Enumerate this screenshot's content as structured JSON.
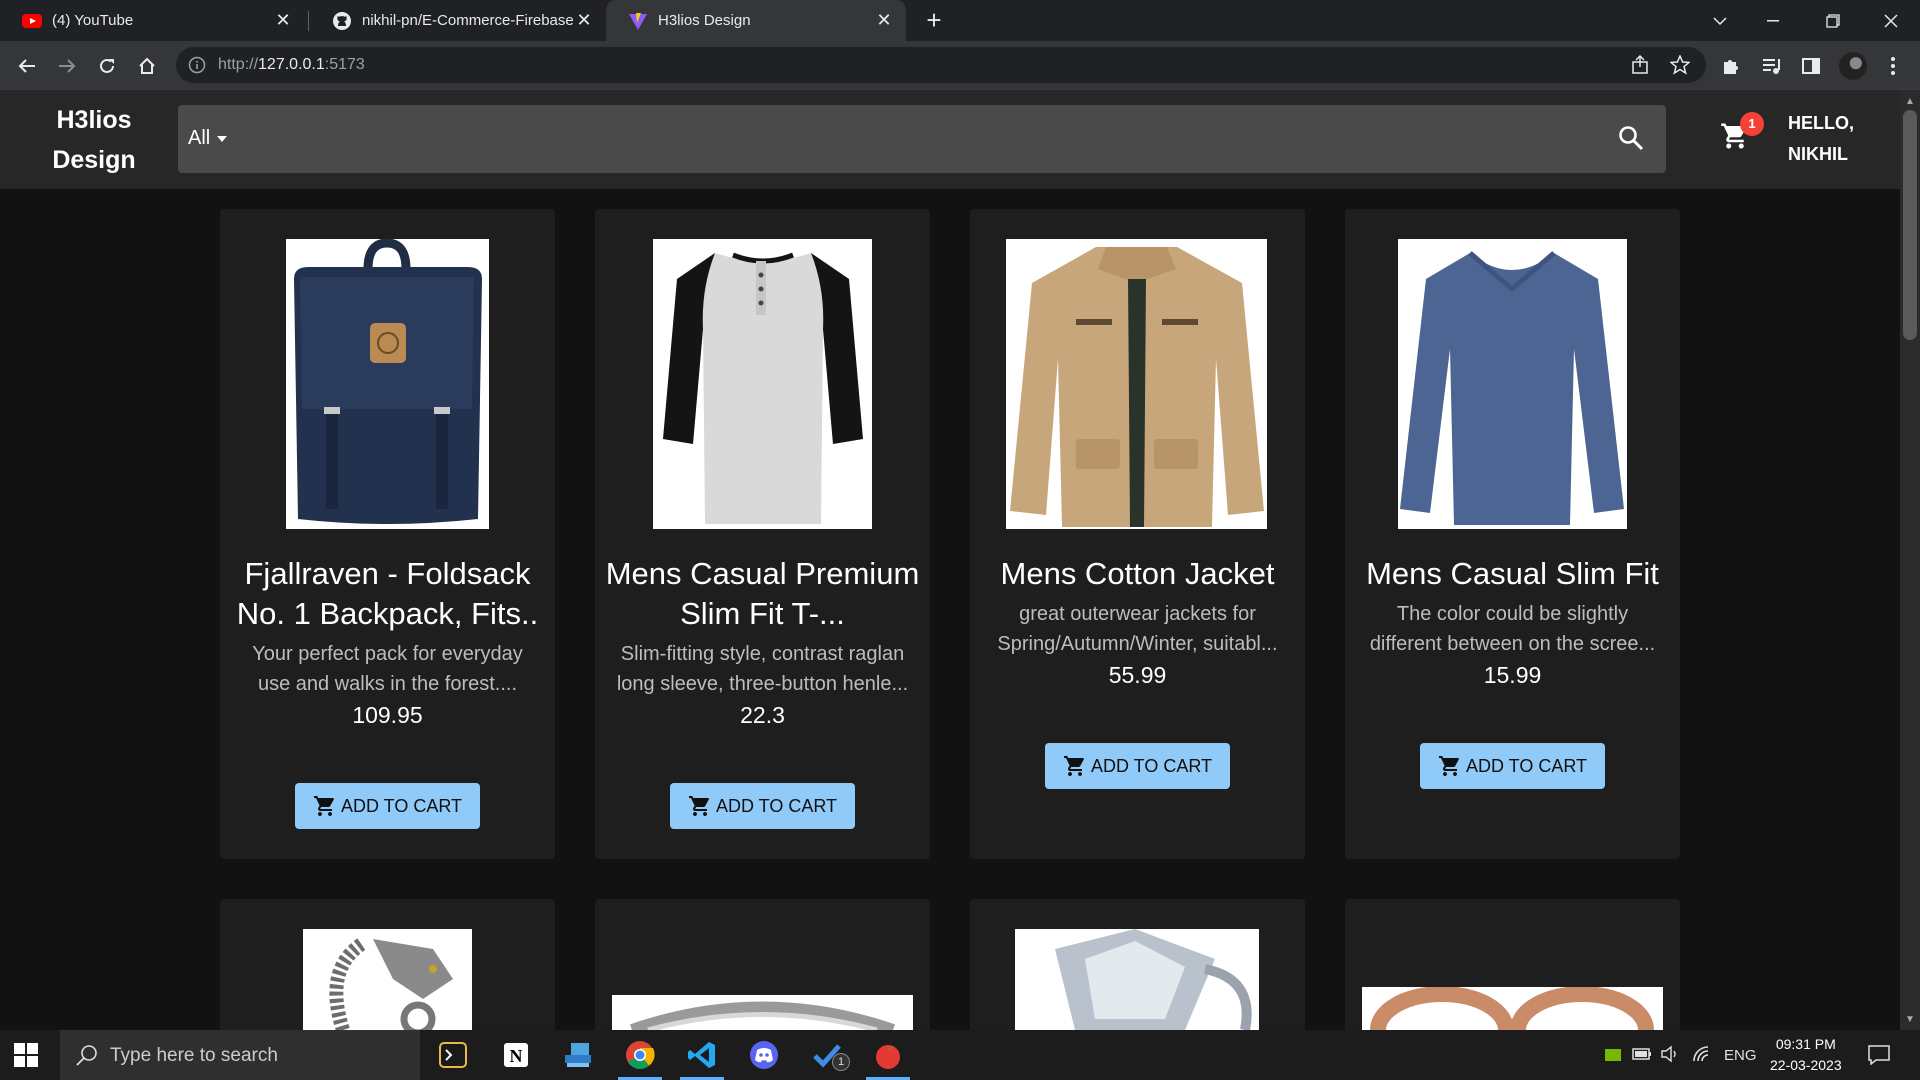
{
  "browser": {
    "tabs": [
      {
        "title": "(4) YouTube"
      },
      {
        "title": "nikhil-pn/E-Commerce-Firebase-"
      },
      {
        "title": "H3lios Design"
      }
    ],
    "url_prefix": "http://",
    "url_host": "127.0.0.1",
    "url_port": ":5173"
  },
  "app": {
    "brand": "H3lios\nDesign",
    "search_category": "All",
    "cart_count": "1",
    "greeting_line1": "HELLO,",
    "greeting_line2": "NIKHIL",
    "accent_color": "#90caf9"
  },
  "products": [
    {
      "title": "Fjallraven - Foldsack No. 1 Backpack, Fits..",
      "description": "Your perfect pack for everyday use and walks in the forest....",
      "price": "109.95",
      "button": "ADD TO CART",
      "image": "backpack-image"
    },
    {
      "title": "Mens Casual Premium Slim Fit T-...",
      "description": "Slim-fitting style, contrast raglan long sleeve, three-button henle...",
      "price": "22.3",
      "button": "ADD TO CART",
      "image": "raglan-tshirt-image"
    },
    {
      "title": "Mens Cotton Jacket",
      "description": "great outerwear jackets for Spring/Autumn/Winter, suitabl...",
      "price": "55.99",
      "button": "ADD TO CART",
      "image": "cotton-jacket-image"
    },
    {
      "title": "Mens Casual Slim Fit",
      "description": "The color could be slightly different between on the scree...",
      "price": "15.99",
      "button": "ADD TO CART",
      "image": "longsleeve-shirt-image"
    }
  ],
  "taskbar": {
    "search_placeholder": "Type here to search",
    "language": "ENG",
    "time": "09:31 PM",
    "date": "22-03-2023",
    "todo_badge": "1"
  }
}
